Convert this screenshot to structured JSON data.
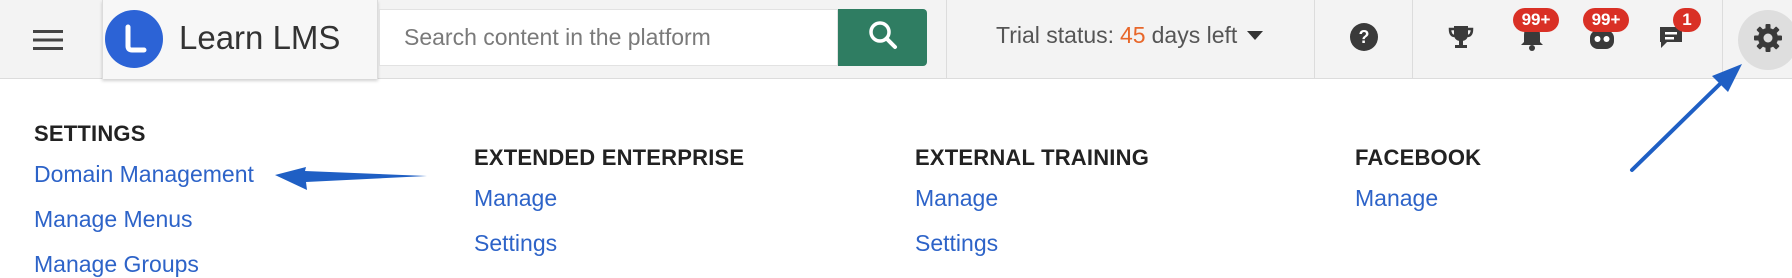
{
  "header": {
    "logo_text": "Learn LMS",
    "search": {
      "placeholder": "Search content in the platform",
      "value": ""
    },
    "trial": {
      "prefix": "Trial status:",
      "days": "45",
      "suffix": "days left"
    },
    "badges": {
      "notifications": "99+",
      "messages_bot": "99+",
      "chat": "1"
    },
    "icons": [
      "menu-icon",
      "search-icon",
      "help-icon",
      "trophy-icon",
      "bell-icon",
      "bot-icon",
      "chat-icon",
      "gear-icon"
    ],
    "colors": {
      "search_button": "#2f7d62",
      "trial_days": "#e8672a",
      "badge": "#d93025",
      "logo": "#2c63d6"
    }
  },
  "menu": {
    "settings": {
      "title": "SETTINGS",
      "links": [
        "Domain Management",
        "Manage Menus",
        "Manage Groups"
      ]
    },
    "extended_enterprise": {
      "title": "EXTENDED ENTERPRISE",
      "links": [
        "Manage",
        "Settings"
      ]
    },
    "external_training": {
      "title": "EXTERNAL TRAINING",
      "links": [
        "Manage",
        "Settings"
      ]
    },
    "facebook": {
      "title": "FACEBOOK",
      "links": [
        "Manage"
      ]
    },
    "link_color": "#2d63c8"
  },
  "annotations": {
    "arrow_color": "#1f5fc4"
  }
}
